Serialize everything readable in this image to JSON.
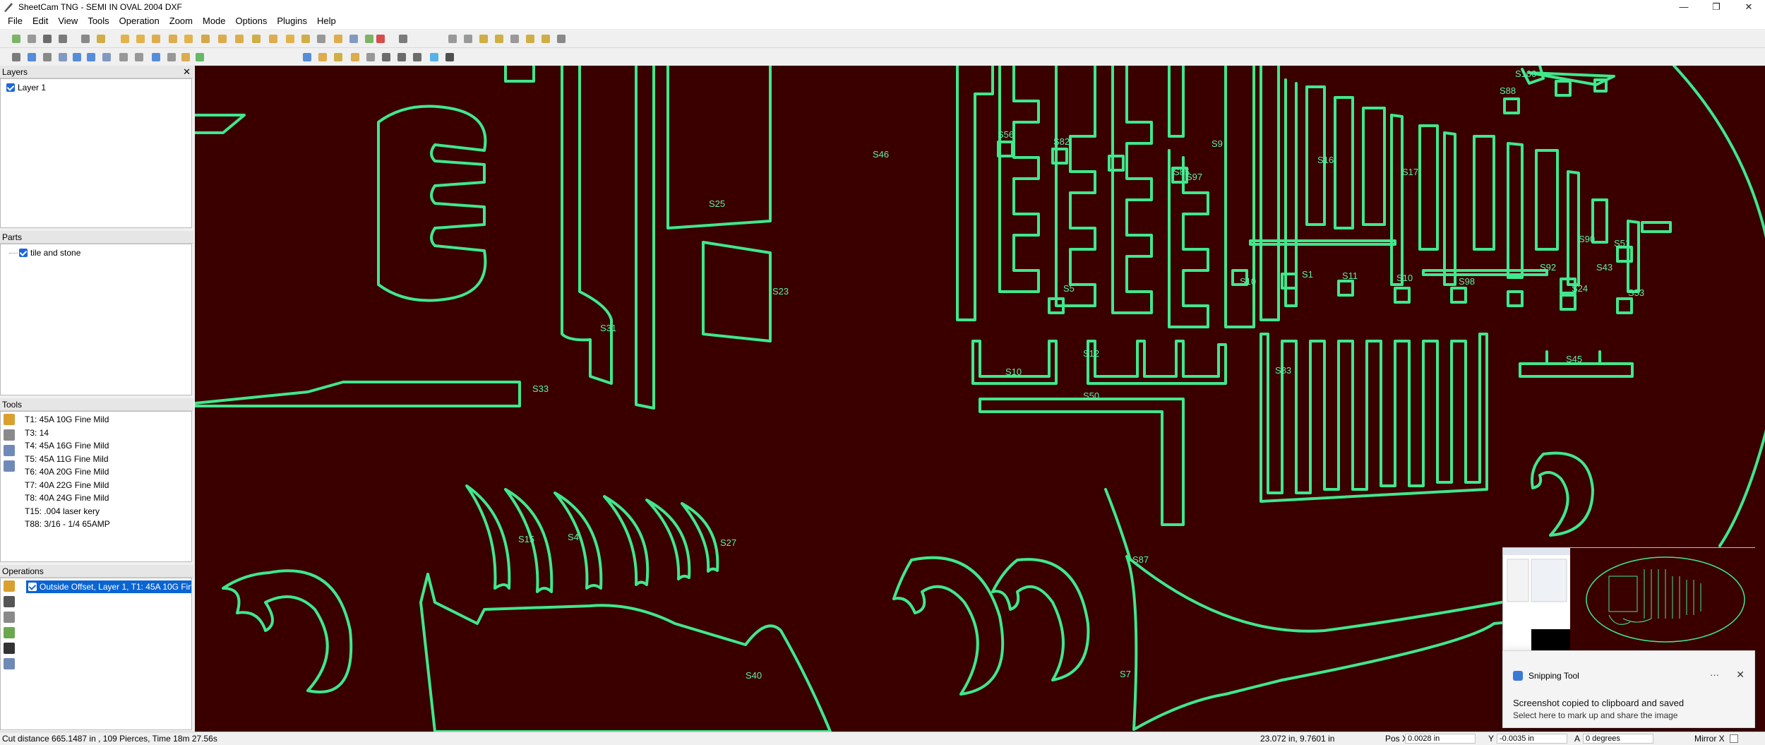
{
  "window": {
    "title": "SheetCam TNG - SEMI IN OVAL 2004 DXF",
    "minimize": "—",
    "maximize": "❐",
    "close": "✕"
  },
  "menu": [
    "File",
    "Edit",
    "View",
    "Tools",
    "Operation",
    "Zoom",
    "Mode",
    "Options",
    "Plugins",
    "Help"
  ],
  "panels": {
    "layers": {
      "title": "Layers",
      "close": "✕",
      "items": [
        "Layer 1"
      ]
    },
    "parts": {
      "title": "Parts",
      "items": [
        "tile and stone"
      ]
    },
    "tools": {
      "title": "Tools",
      "items": [
        "T1: 45A 10G Fine Mild",
        "T3: 14",
        "T4: 45A 16G Fine Mild",
        "T5: 45A 11G Fine Mild",
        "T6: 40A 20G Fine Mild",
        "T7: 40A 22G Fine Mild",
        "T8: 40A 24G Fine Mild",
        "T15: .004 laser kery",
        "T88: 3/16 - 1/4 65AMP"
      ]
    },
    "operations": {
      "title": "Operations",
      "items": [
        "Outside Offset, Layer 1, T1: 45A 10G Fine ..."
      ]
    }
  },
  "canvas": {
    "background": "#3a0000",
    "path_color": "#3fe88c",
    "part_labels": [
      "S46",
      "S56",
      "S82",
      "S9",
      "S85",
      "S97",
      "S10",
      "S5",
      "S16",
      "S17",
      "S11",
      "S100",
      "S88",
      "S90",
      "S51",
      "S92",
      "S43",
      "S24",
      "S53",
      "S98",
      "S10",
      "S1",
      "S45",
      "S12",
      "S10",
      "S50",
      "S83",
      "S23",
      "S25",
      "S31",
      "S33",
      "S15",
      "S4",
      "S27",
      "S87",
      "S40",
      "S7"
    ]
  },
  "status": {
    "cut_info": "Cut distance 665.1487 in , 109 Pierces, Time 18m 27.56s",
    "cursor": "23.072 in, 9.7601 in",
    "pos_x_label": "Pos X",
    "pos_x_value": "0.0028 in",
    "y_label": "Y",
    "y_value": "-0.0035 in",
    "angle_label": "A",
    "angle_value": "0 degrees",
    "mirror_label": "Mirror X"
  },
  "notification": {
    "app": "Snipping Tool",
    "more": "···",
    "close": "✕",
    "title": "Screenshot copied to clipboard and saved",
    "body": "Select here to mark up and share the image"
  }
}
